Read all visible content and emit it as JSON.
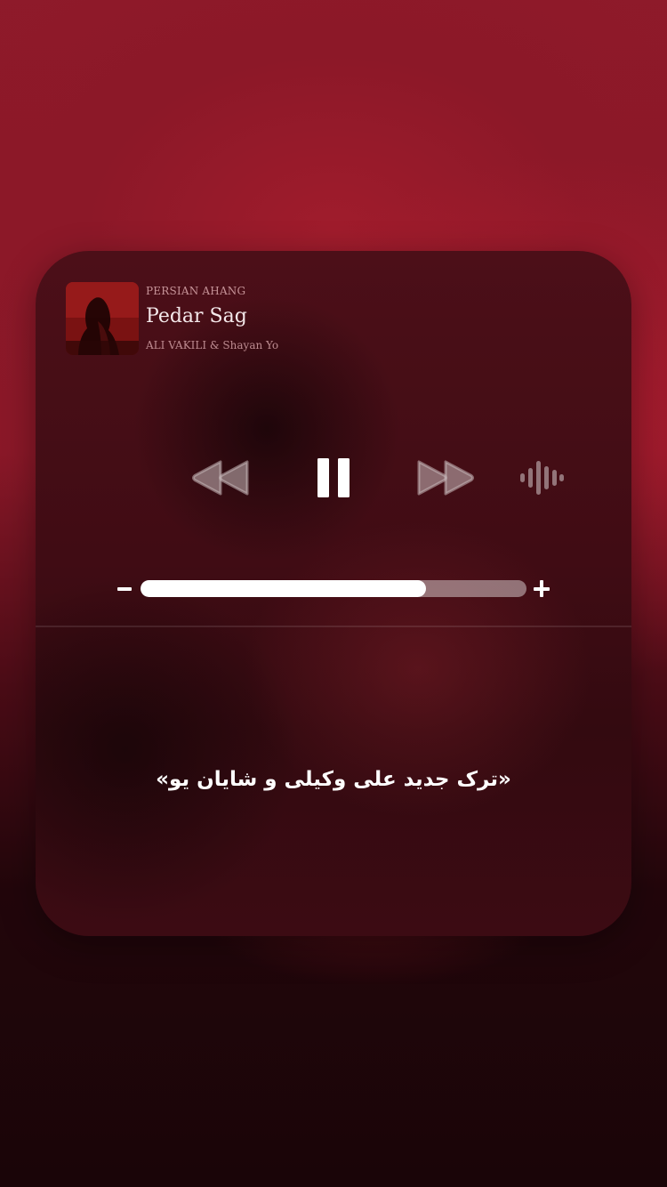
{
  "now_playing": {
    "app_name": "PERSIAN AHANG",
    "title": "Pedar Sag",
    "artist": "ALI VAKILI & Shayan Yo"
  },
  "controls": {
    "rewind_icon": "rewind-icon",
    "pause_icon": "pause-icon",
    "forward_icon": "fast-forward-icon",
    "audio_icon": "audio-waveform-icon"
  },
  "volume": {
    "level": 0.74,
    "minus_icon": "volume-minus-icon",
    "plus_icon": "volume-plus-icon"
  },
  "caption": "«ترک جدید علی وکیلی و شایان یو»",
  "colors": {
    "background": "#8f1a2a",
    "card": "#400c14",
    "accent": "#ffffff"
  }
}
